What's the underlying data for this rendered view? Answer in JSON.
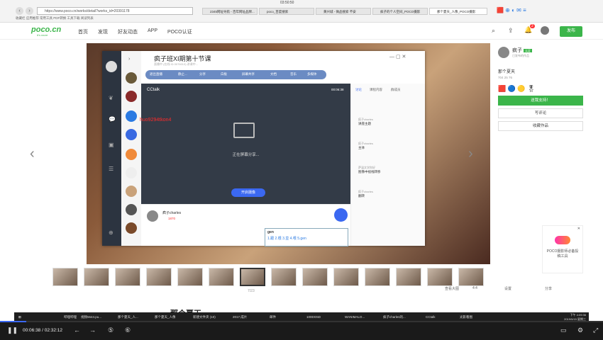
{
  "browser": {
    "url": "https://www.poco.cn/works/detail?works_id=20391178",
    "clock": "03:50:50",
    "bookmarks": "收藏栏   应用推荐   常用工具   PDF转换   工具下载   阅读列表",
    "tabs": [
      "2345网址导航 - 百年网址品牌...",
      "poco_百度搜索",
      "黄兴城 - 微品搜索  不安",
      "疯子的个人空间_POCO摄影",
      "那个夏天_人像_POCO摄影"
    ]
  },
  "poco": {
    "logo": "poco.cn",
    "logo_sub": "It's more",
    "nav": [
      "首页",
      "发现",
      "好友动态",
      "APP",
      "POCO认证"
    ],
    "publish": "发布",
    "notif_count": "2"
  },
  "cctalk": {
    "title": "疯子班XI期第十节课",
    "subtitle": "直播中 (在线 ID:3076013) 讲课中...",
    "toolbar": [
      "退出直播",
      "静止...",
      "分享",
      "白板",
      "屏幕共享",
      "文档",
      "音乐",
      "多媒体"
    ],
    "video_label": "CCtalk",
    "time": "00:06:38",
    "share_status": "正在屏幕分享...",
    "open_button": "开启摄像",
    "right_tabs": [
      "讨论",
      "课程内容",
      "群成员"
    ],
    "messages": [
      {
        "name": "疯子charles",
        "text": "讲座主题"
      },
      {
        "name": "疯子charles",
        "text": "主体"
      },
      {
        "name": "萨温文学你好",
        "text": "图像中视线转移"
      },
      {
        "name": "疯子charles",
        "text": "翻转"
      }
    ],
    "user_name": "疯子charles",
    "user_count": "1870",
    "ime_input": "gen",
    "ime_candidates": "1.跟  2.根  3.亘  4.哏  5.gen"
  },
  "overlay_text": "huo9294tkon4",
  "sidebar": {
    "author": "疯子",
    "author_badge": "认证",
    "author_desc": "已发布的作品",
    "title": "那个夏天",
    "stats": "704   25   76",
    "support_btn": "送我支持！",
    "comment_btn": "写评论",
    "collect_btn": "收藏作品"
  },
  "ad": {
    "text": "POCO摄影师必备投稿工具"
  },
  "gallery": {
    "page": "7/23",
    "view_all": "查看大图",
    "zoom": "4:4",
    "heading": "那个夏天",
    "settings": "设置",
    "share": "分享"
  },
  "taskbar": {
    "items": [
      "哔哩哔哩",
      "视频5644.pu...",
      "那个夏天_人...",
      "那个夏天_人像",
      "新建文件夹 (10)",
      "2017.成片",
      "邮件",
      "100DG5D",
      "WANIMALO...",
      "疯子charles的...",
      "CCtalk",
      "光影看图"
    ],
    "time": "下午 4:09:36",
    "date": "2019/5/15 星期三"
  },
  "player": {
    "current": "00:06:38",
    "total": "02:32:12",
    "progress": 0.044
  }
}
